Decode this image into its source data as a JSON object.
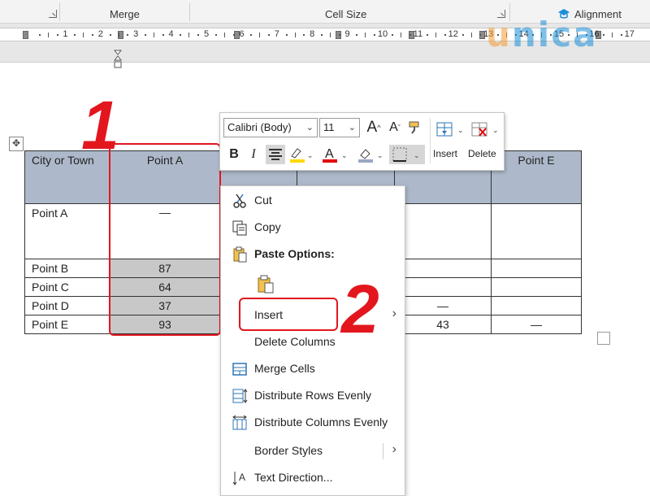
{
  "ribbon": {
    "groups": [
      {
        "label": "Merge"
      },
      {
        "label": "Cell Size"
      },
      {
        "label": "Alignment"
      }
    ]
  },
  "ruler": {
    "numbers": [
      "1",
      "2",
      "3",
      "4",
      "5",
      "6",
      "7",
      "8",
      "9",
      "10",
      "11",
      "12",
      "13",
      "14",
      "15",
      "16",
      "17"
    ]
  },
  "logo": {
    "text_u": "u",
    "text_rest": "nica"
  },
  "table": {
    "headers": [
      "City or Town",
      "Point A",
      "",
      "",
      "",
      "Point E"
    ],
    "rows": [
      {
        "city": "Point A",
        "a": "—",
        "d": "",
        "e": ""
      },
      {
        "city": "Point B",
        "a": "87",
        "d": "",
        "e": ""
      },
      {
        "city": "Point C",
        "a": "64",
        "d": "",
        "e": ""
      },
      {
        "city": "Point D",
        "a": "37",
        "d": "—",
        "e": ""
      },
      {
        "city": "Point E",
        "a": "93",
        "d": "43",
        "e": "—"
      }
    ]
  },
  "annotations": {
    "step1": "1",
    "step2": "2"
  },
  "mini_toolbar": {
    "font": "Calibri (Body)",
    "size": "11",
    "insert_label": "Insert",
    "delete_label": "Delete",
    "bold": "B",
    "italic": "I",
    "colors": {
      "highlight": "#ffd800",
      "font_color": "#e00000",
      "shading": "#9aa8c4"
    }
  },
  "context_menu": {
    "items": [
      {
        "label": "Cut",
        "icon": "scissors-icon"
      },
      {
        "label": "Copy",
        "icon": "copy-icon"
      },
      {
        "label": "Paste Options:",
        "icon": "paste-icon"
      },
      {
        "label": "Insert",
        "icon": "",
        "submenu": true
      },
      {
        "label": "Delete Columns",
        "icon": ""
      },
      {
        "label": "Merge Cells",
        "icon": "merge-cells-icon"
      },
      {
        "label": "Distribute Rows Evenly",
        "icon": "distribute-rows-icon"
      },
      {
        "label": "Distribute Columns Evenly",
        "icon": "distribute-columns-icon"
      },
      {
        "label": "Border Styles",
        "icon": "",
        "submenu": true
      },
      {
        "label": "Text Direction...",
        "icon": "text-direction-icon"
      }
    ]
  },
  "colors": {
    "accent_red": "#e3161e",
    "header_fill": "#adb9ca",
    "selected_fill": "#c8c8c8"
  }
}
